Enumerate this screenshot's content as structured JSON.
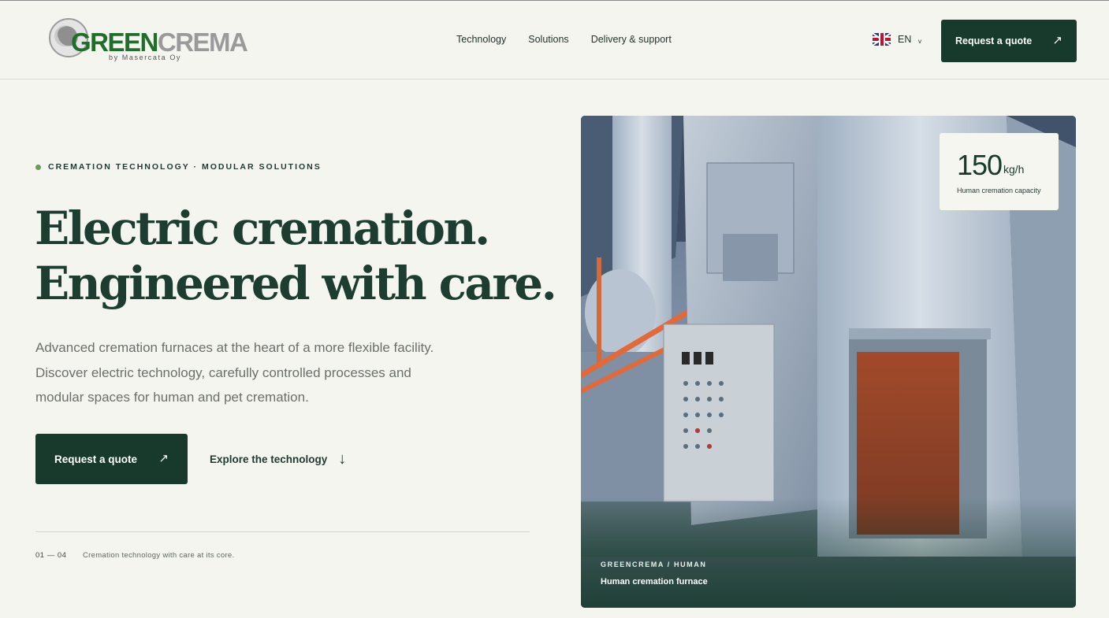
{
  "brand": {
    "logo_part1": "GREEN",
    "logo_part2": "CREMA",
    "logo_sub": "by Masercata Oy"
  },
  "nav": {
    "items": [
      {
        "label": "Technology"
      },
      {
        "label": "Solutions"
      },
      {
        "label": "Delivery & support"
      }
    ]
  },
  "language": {
    "code": "EN",
    "caret": "˅",
    "flag": "uk-flag-icon"
  },
  "header": {
    "cta_label": "Request a quote",
    "cta_icon": "↗"
  },
  "hero": {
    "eyebrow": "CREMATION TECHNOLOGY · MODULAR SOLUTIONS",
    "headline_line1": "Electric cremation.",
    "headline_line2": "Engineered with care.",
    "lead": "Advanced cremation furnaces at the heart of a more flexible facility. Discover electric technology, carefully controlled processes and modular spaces for human and pet cremation.",
    "cta_label": "Request a quote",
    "cta_icon": "↗",
    "explore_label": "Explore the technology",
    "explore_icon": "↓",
    "counter": "01 — 04",
    "counter_text": "Cremation technology with care at its core."
  },
  "image_card": {
    "capacity_value": "150",
    "capacity_unit": "kg/h",
    "capacity_label": "Human cremation capacity",
    "eyebrow": "GREENCREMA / HUMAN",
    "caption": "Human cremation furnace"
  },
  "colors": {
    "background": "#f5f5f0",
    "primary": "#173a2d",
    "accent_dot": "#6a9a5a",
    "logo_green": "#1f6e2a"
  }
}
